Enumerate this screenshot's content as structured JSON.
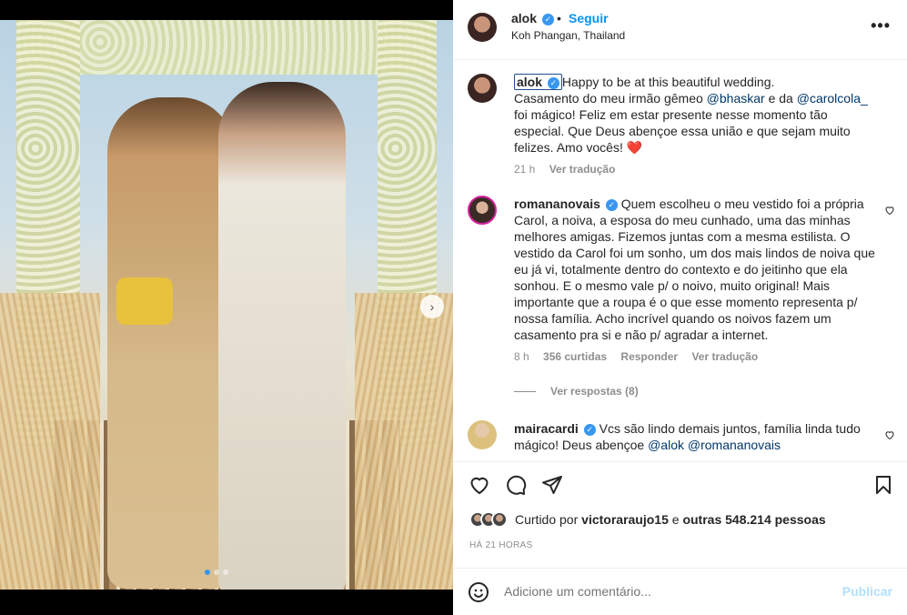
{
  "post": {
    "username": "alok",
    "dot": "•",
    "follow_label": "Seguir",
    "location": "Koh Phangan, Thailand",
    "more_icon": "more-horizontal-icon",
    "carousel_next_icon": "chevron-right-icon",
    "carousel_total": 3,
    "carousel_active": 1
  },
  "caption": {
    "username": "alok",
    "line1": "Happy to be at this beautiful wedding.",
    "text_a": "Casamento do meu irmão gêmeo ",
    "mention1": "@bhaskar",
    "text_b": " e da ",
    "mention2": "@carolcola_",
    "text_c": " foi mágico! Feliz em estar presente nesse momento tão especial. Que Deus abençoe essa união e que sejam muito felizes. Amo vocês! ",
    "heart": "❤️",
    "time": "21 h",
    "translate": "Ver tradução"
  },
  "comments": [
    {
      "username": "romananovais",
      "text": "Quem escolheu o meu vestido foi a própria Carol, a noiva, a esposa do meu cunhado, uma das minhas melhores amigas. Fizemos juntas com a mesma estilista. O vestido da Carol foi um sonho, um dos mais lindos de noiva que eu já vi, totalmente dentro do contexto e do jeitinho que ela sonhou. E o mesmo vale p/ o noivo, muito original! Mais importante que a roupa é o que esse momento representa p/ nossa família. Acho incrível quando os noivos fazem um casamento pra si e não p/ agradar a internet.",
      "time": "8 h",
      "likes": "356 curtidas",
      "reply": "Responder",
      "translate": "Ver tradução",
      "view_replies": "Ver respostas (8)"
    },
    {
      "username": "mairacardi",
      "text": "Vcs são lindo demais juntos, família linda tudo mágico! Deus abençoe ",
      "mention1": "@alok",
      "mention2": "@romananovais"
    }
  ],
  "footer": {
    "liked_prefix": "Curtido por",
    "liked_user": "victoraraujo15",
    "liked_mid": "e",
    "liked_others": "outras 548.214 pessoas",
    "timestamp": "HÁ 21 HORAS",
    "comment_placeholder": "Adicione um comentário...",
    "publish_label": "Publicar"
  },
  "colors": {
    "link_blue": "#0095f6",
    "verified_blue": "#3897f0",
    "mention_blue": "#00376b",
    "publish_disabled": "#b2dffc",
    "heart_red": "#ed4956"
  }
}
